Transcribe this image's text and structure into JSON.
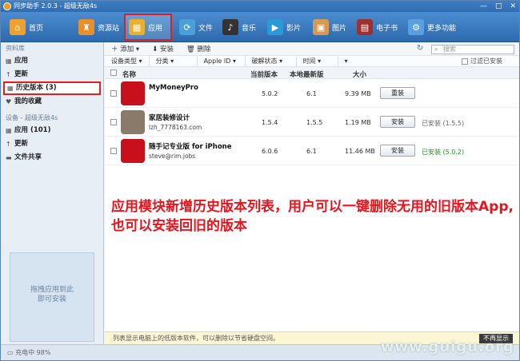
{
  "titlebar": {
    "title": "同步助手 2.0.3 - 超级无敌4s",
    "min": "—",
    "max": "□",
    "close": "✕"
  },
  "toolbar": [
    {
      "id": "home",
      "label": "首页",
      "icon": "home-icon",
      "color": "#f0a030",
      "glyph": "⌂"
    },
    {
      "id": "resources",
      "label": "资源站",
      "icon": "bag-icon",
      "color": "#e8902c",
      "glyph": "♜"
    },
    {
      "id": "apps",
      "label": "应用",
      "icon": "apps-icon",
      "color": "#e9b030",
      "glyph": "▦",
      "active": true
    },
    {
      "id": "files",
      "label": "文件",
      "icon": "sync-files-icon",
      "color": "#4aa0d8",
      "glyph": "⟳"
    },
    {
      "id": "music",
      "label": "音乐",
      "icon": "music-icon",
      "color": "#333333",
      "glyph": "♪"
    },
    {
      "id": "video",
      "label": "影片",
      "icon": "video-icon",
      "color": "#2a9ad8",
      "glyph": "▶"
    },
    {
      "id": "photos",
      "label": "图片",
      "icon": "photo-icon",
      "color": "#d89a50",
      "glyph": "▣"
    },
    {
      "id": "ebook",
      "label": "电子书",
      "icon": "ebook-icon",
      "color": "#a03030",
      "glyph": "▤"
    },
    {
      "id": "more",
      "label": "更多功能",
      "icon": "more-icon",
      "color": "#5aa0e0",
      "glyph": "⚙"
    }
  ],
  "sidebar": {
    "library_head": "资料库",
    "library": [
      {
        "label": "应用",
        "icon": "grid-icon",
        "glyph": "▦"
      },
      {
        "label": "更新",
        "icon": "arrow-up-icon",
        "glyph": "↑"
      },
      {
        "label": "历史版本 (3)",
        "icon": "history-icon",
        "glyph": "▦",
        "selected": true
      },
      {
        "label": "我的收藏",
        "icon": "heart-icon",
        "glyph": "♥"
      }
    ],
    "device_head": "设备 - 超级无敌4s",
    "device": [
      {
        "label": "应用 (101)",
        "icon": "grid-icon",
        "glyph": "▦"
      },
      {
        "label": "更新",
        "icon": "arrow-up-icon",
        "glyph": "↑"
      },
      {
        "label": "文件共享",
        "icon": "folder-icon",
        "glyph": "▬"
      }
    ],
    "drop_hint": "拖拽应用到此\n即可安装"
  },
  "actions": {
    "add": "添加",
    "install": "安装",
    "delete": "删除",
    "search_placeholder": "搜索"
  },
  "filters": [
    "设备类型",
    "分类",
    "Apple ID",
    "破解状态",
    "时间",
    "",
    "过滤已安装"
  ],
  "columns": {
    "name": "名称",
    "current": "当前版本",
    "latest": "本地最新版",
    "size": "大小"
  },
  "rows": [
    {
      "name": "MyMoneyPro",
      "sub": "",
      "current": "5.0.2",
      "latest": "6.1",
      "size": "9.39 MB",
      "button": "重装",
      "status": "",
      "status_color": "#333333",
      "icon_color": "#c8101c"
    },
    {
      "name": "家居装修设计",
      "sub": "lzh_7778163.com",
      "current": "1.5.4",
      "latest": "1.5.5",
      "size": "1.19 MB",
      "button": "安装",
      "status": "已安装 (1.5.5)",
      "status_color": "#666666",
      "icon_color": "#8a7a6a"
    },
    {
      "name": "随手记专业版 for iPhone",
      "sub": "steve@rim.jobs",
      "current": "6.0.6",
      "latest": "6.1",
      "size": "11.46 MB",
      "button": "安装",
      "status": "已安装 (5.0.2)",
      "status_color": "#1a9a1a",
      "icon_color": "#c8101c"
    }
  ],
  "annotation": "应用模块新增历史版本列表，用户可以一键删除无用的旧版本App,也可以安装回旧的版本",
  "notice": {
    "text": "列表显示电脑上的低版本软件，可以删除以节省硬盘空间。",
    "button": "不再显示"
  },
  "status": {
    "text": "充电中 98%"
  },
  "watermark": "www.guigu.org"
}
